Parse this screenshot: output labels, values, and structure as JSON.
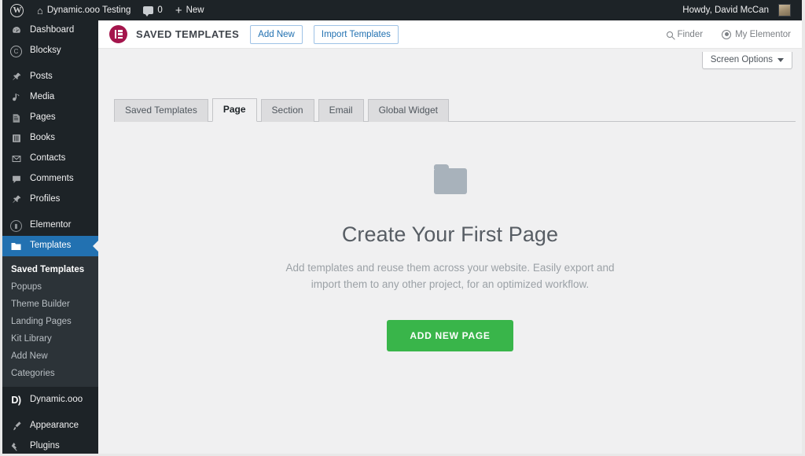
{
  "adminbar": {
    "wp_logo": "wordpress-logo",
    "site_name": "Dynamic.ooo Testing",
    "comments_count": "0",
    "new_label": "New",
    "howdy": "Howdy, David McCan"
  },
  "sidebar": {
    "items": [
      {
        "label": "Dashboard",
        "icon": "dashboard-icon",
        "gap_after": false
      },
      {
        "label": "Blocksy",
        "icon": "blocksy-icon",
        "gap_after": true
      },
      {
        "label": "Posts",
        "icon": "pin-icon",
        "gap_after": false
      },
      {
        "label": "Media",
        "icon": "media-icon",
        "gap_after": false
      },
      {
        "label": "Pages",
        "icon": "page-icon",
        "gap_after": false
      },
      {
        "label": "Books",
        "icon": "book-icon",
        "gap_after": false
      },
      {
        "label": "Contacts",
        "icon": "envelope-icon",
        "gap_after": false
      },
      {
        "label": "Comments",
        "icon": "comment-icon",
        "gap_after": false
      },
      {
        "label": "Profiles",
        "icon": "pin-icon",
        "gap_after": true
      },
      {
        "label": "Elementor",
        "icon": "elementor-icon",
        "gap_after": false
      }
    ],
    "current": {
      "label": "Templates",
      "icon": "folder-icon"
    },
    "submenu": [
      {
        "label": "Saved Templates",
        "active": true
      },
      {
        "label": "Popups",
        "active": false
      },
      {
        "label": "Theme Builder",
        "active": false
      },
      {
        "label": "Landing Pages",
        "active": false
      },
      {
        "label": "Kit Library",
        "active": false
      },
      {
        "label": "Add New",
        "active": false
      },
      {
        "label": "Categories",
        "active": false
      }
    ],
    "after_items": [
      {
        "label": "Dynamic.ooo",
        "icon": "dynamic-ooo-icon",
        "gap_after": true
      },
      {
        "label": "Appearance",
        "icon": "brush-icon",
        "gap_after": false
      },
      {
        "label": "Plugins",
        "icon": "plug-icon",
        "gap_after": false
      }
    ],
    "accent_color": "#2271b1",
    "bg_color": "#1d2327"
  },
  "elementor_header": {
    "logo": "elementor-logo",
    "title": "SAVED TEMPLATES",
    "add_new_label": "Add New",
    "import_label": "Import Templates",
    "finder_label": "Finder",
    "my_elementor_label": "My Elementor",
    "brand_color": "#a4154c",
    "link_color": "#2271b1"
  },
  "screen_options": {
    "label": "Screen Options"
  },
  "tabs": [
    {
      "label": "Saved Templates",
      "active": false
    },
    {
      "label": "Page",
      "active": true
    },
    {
      "label": "Section",
      "active": false
    },
    {
      "label": "Email",
      "active": false
    },
    {
      "label": "Global Widget",
      "active": false
    }
  ],
  "empty_state": {
    "icon": "folder-icon",
    "heading": "Create Your First Page",
    "description_line1": "Add templates and reuse them across your website. Easily export and",
    "description_line2": "import them to any other project, for an optimized workflow.",
    "button_label": "ADD NEW PAGE",
    "button_color": "#39b54a"
  }
}
